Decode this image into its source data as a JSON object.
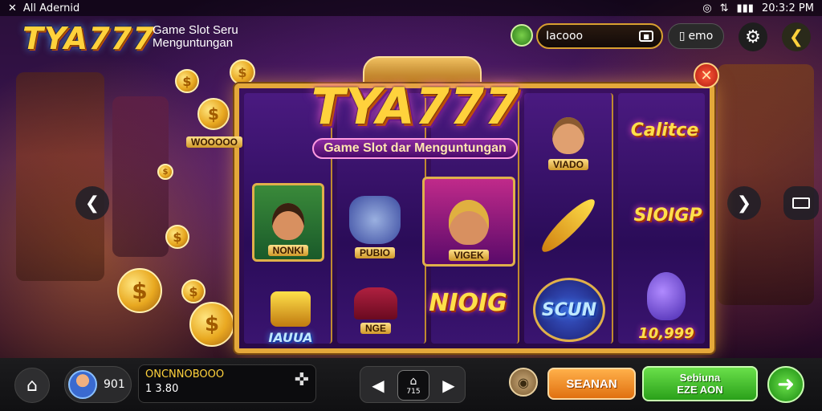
{
  "status_bar": {
    "left_text": "All Adernid",
    "time": "20:3:2 PM"
  },
  "header": {
    "logo": "TYA777",
    "tagline_line1": "Game Slot Seru",
    "tagline_line2": "Menguntungan",
    "balance": "Iacooo",
    "memo_label": "emo"
  },
  "machine": {
    "title": "TYA777",
    "subtitle": "Game Slot dar Menguntungan",
    "symbols": {
      "r1_top": "WOOOOO",
      "r1_mid": "NONKI",
      "r2_mid": "PUBIO",
      "r2_bot": "IAUUA",
      "r3_mid": "VIGEK",
      "r3_bot_label": "NGE",
      "r3_bot_text": "NIOIG",
      "r4_top": "VIADO",
      "r4_bot": "SCUN",
      "r5_top": "Calitce",
      "r5_mid": "SIOIGP",
      "r5_bot": "10,999"
    }
  },
  "footer": {
    "profile_value": "901",
    "wallet_line1": "ONCNNOBOOO",
    "wallet_line2": "1 3.80",
    "center_mid_label": "715",
    "orange_button": "SEANAN",
    "green_button_line1": "Sebiuna",
    "green_button_line2": "EZE AON"
  },
  "colors": {
    "gold": "#ffd23c",
    "machine_frame": "#e4a83a",
    "orange_button": "#e07010",
    "green_button": "#2aa01a"
  }
}
